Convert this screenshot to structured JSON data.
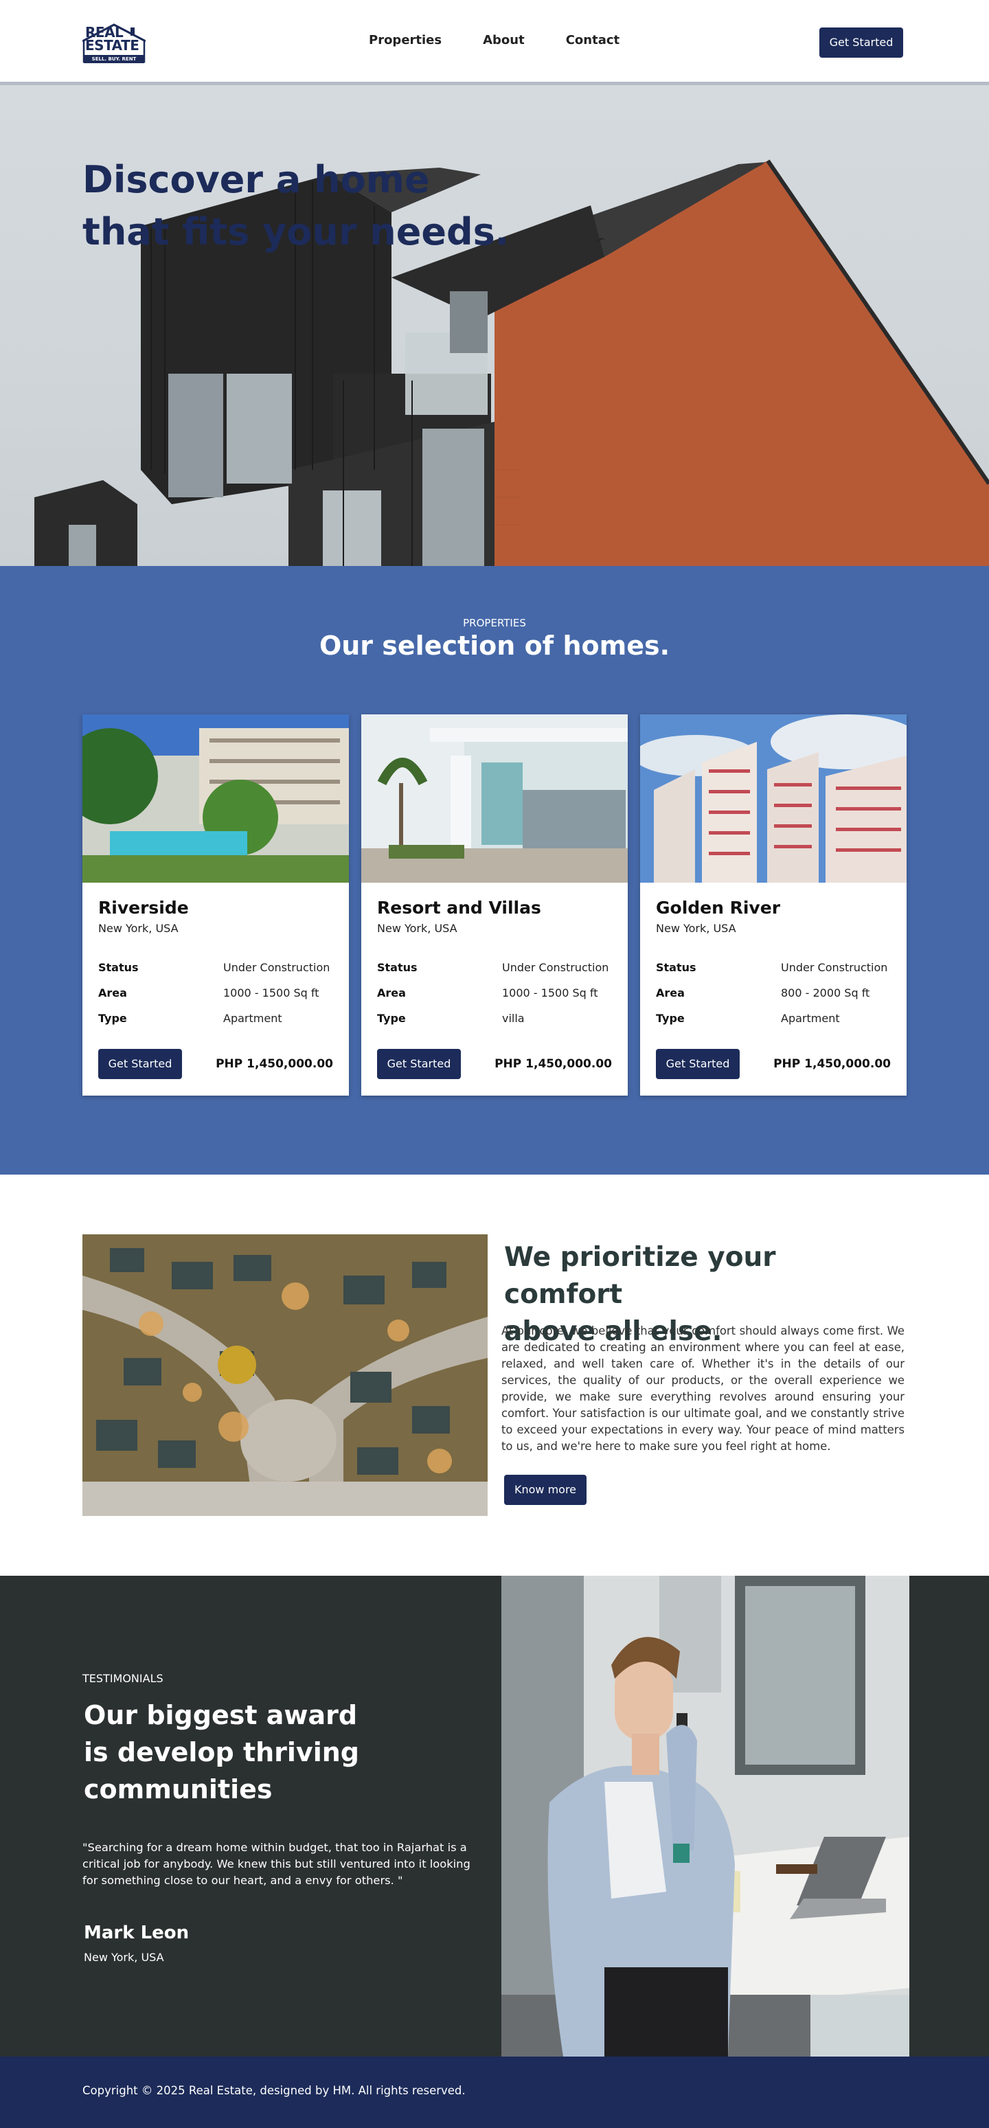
{
  "brand": {
    "logo_line1": "REAL",
    "logo_line2": "ESTATE",
    "logo_tagline": "SELL. BUY. RENT"
  },
  "nav": {
    "links": [
      "Properties",
      "About",
      "Contact"
    ],
    "cta": "Get Started"
  },
  "hero": {
    "title_line1": "Discover a home",
    "title_line2": "that fits your needs."
  },
  "properties": {
    "eyebrow": "PROPERTIES",
    "title": "Our selection of homes.",
    "spec_labels": [
      "Status",
      "Area",
      "Type"
    ],
    "cards": [
      {
        "name": "Riverside",
        "location": "New York, USA",
        "status": "Under Construction",
        "area": "1000 - 1500 Sq ft",
        "type": "Apartment",
        "button": "Get Started",
        "price": "PHP 1,450,000.00"
      },
      {
        "name": "Resort and Villas",
        "location": "New York, USA",
        "status": "Under Construction",
        "area": "1000 - 1500 Sq ft",
        "type": "villa",
        "button": "Get Started",
        "price": "PHP 1,450,000.00"
      },
      {
        "name": "Golden River",
        "location": "New York, USA",
        "status": "Under Construction",
        "area": "800 - 2000 Sq ft",
        "type": "Apartment",
        "button": "Get Started",
        "price": "PHP 1,450,000.00"
      }
    ]
  },
  "comfort": {
    "title_line1": "We prioritize your comfort",
    "title_line2": "above all else.",
    "text": "At our core, we believe that your comfort should always come first. We are dedicated to creating an environment where you can feel at ease, relaxed, and well taken care of. Whether it's in the details of our services, the quality of our products, or the overall experience we provide, we make sure everything revolves around ensuring your comfort. Your satisfaction is our ultimate goal, and we constantly strive to exceed your expectations in every way. Your peace of mind matters to us, and we're here to make sure you feel right at home.",
    "button": "Know more"
  },
  "testimonials": {
    "eyebrow": "TESTIMONIALS",
    "title_line1": "Our biggest award",
    "title_line2": "is develop thriving",
    "title_line3": "communities",
    "quote": "\"Searching for a dream home within budget, that too in Rajarhat is a critical job for anybody. We knew this but still ventured into it looking for something close to our heart, and a envy for others. \"",
    "name": "Mark Leon",
    "location": "New York, USA"
  },
  "footer": {
    "copyright": "Copyright © 2025 Real Estate, designed by HM. All rights reserved."
  },
  "colors": {
    "navy": "#1c2b59",
    "properties_bg": "#4668a8",
    "testimonials_bg": "#2b3130"
  }
}
